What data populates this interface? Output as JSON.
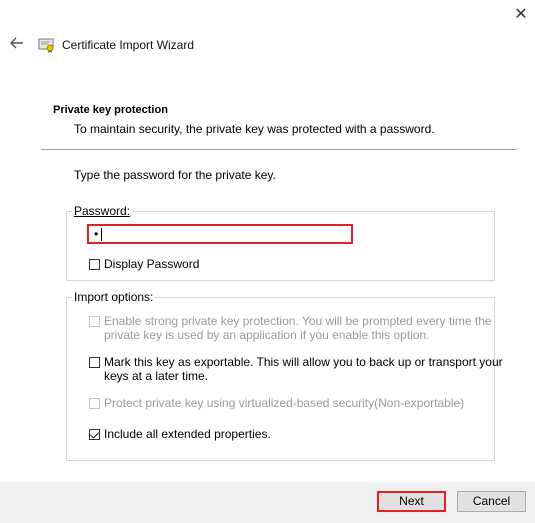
{
  "window": {
    "title": "Certificate Import Wizard",
    "close_icon": "close-icon",
    "back_icon": "back-arrow-icon",
    "app_icon": "certificate-icon"
  },
  "section": {
    "heading": "Private key protection",
    "description": "To maintain security, the private key was protected with a password."
  },
  "prompt": "Type the password for the private key.",
  "password": {
    "legend": "Password:",
    "value": "•",
    "display_password_label": "Display Password",
    "display_password_checked": false
  },
  "import_options": {
    "legend": "Import options:",
    "strong_protection": {
      "line1": "Enable strong private key protection. You will be prompted every time the",
      "line2": "private key is used by an application if you enable this option.",
      "checked": false,
      "enabled": false
    },
    "exportable": {
      "line1": "Mark this key as exportable. This will allow you to back up or transport your",
      "line2": "keys at a later time.",
      "checked": false,
      "enabled": true
    },
    "vbs": {
      "label": "Protect private key using virtualized-based security(Non-exportable)",
      "checked": false,
      "enabled": false
    },
    "extended": {
      "label": "Include all extended properties.",
      "checked": true,
      "enabled": true
    }
  },
  "buttons": {
    "next": "Next",
    "cancel": "Cancel"
  },
  "colors": {
    "highlight": "#e02424",
    "footer": "#f0f0f0"
  }
}
